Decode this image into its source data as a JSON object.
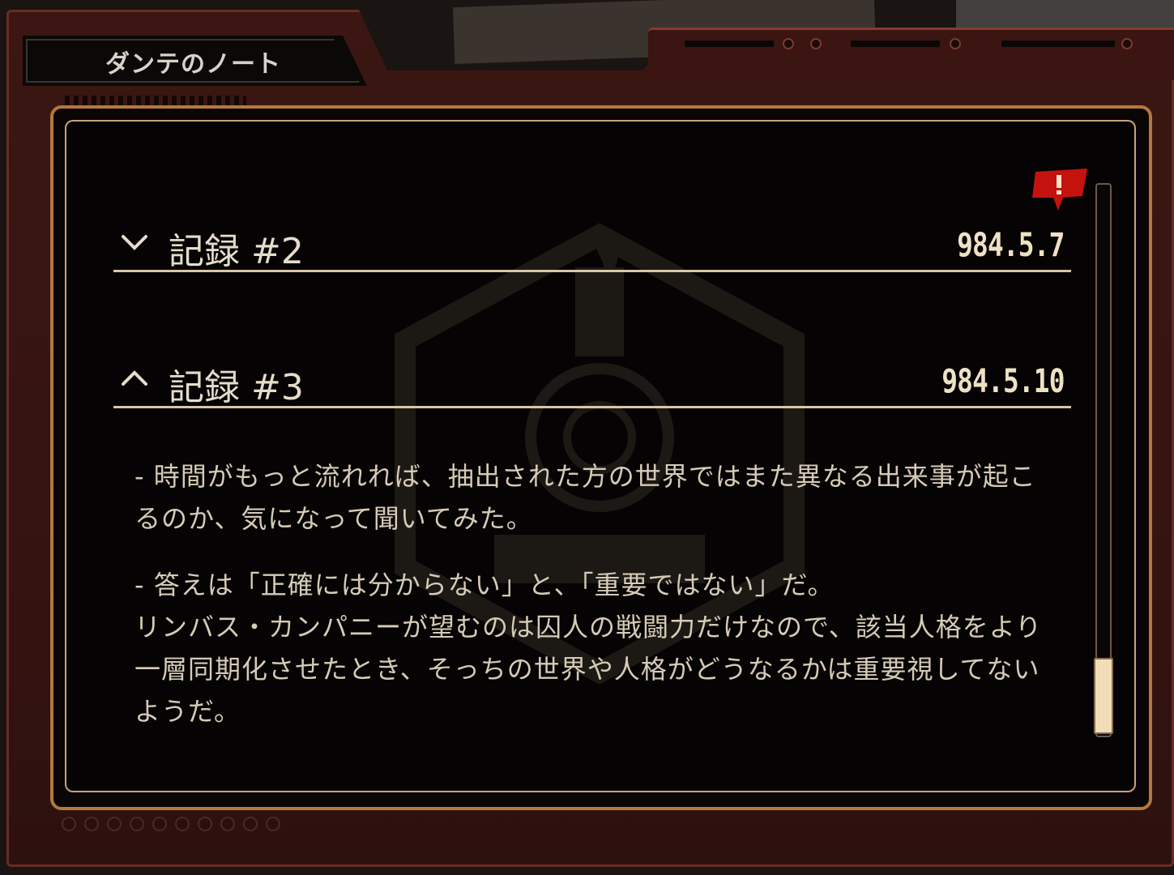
{
  "window": {
    "title": "ダンテのノート"
  },
  "entries": [
    {
      "label": "記録 #2",
      "date": "984.5.7",
      "state": "collapsed",
      "has_alert": true
    },
    {
      "label": "記録 #3",
      "date": "984.5.10",
      "state": "expanded",
      "paragraphs": [
        "- 時間がもっと流れれば、抽出された方の世界ではまた異なる出来事が起こるのか、気になって聞いてみた。",
        "- 答えは「正確には分からない」と、「重要ではない」だ。\nリンバス・カンパニーが望むのは囚人の戦闘力だけなので、該当人格をより一層同期化させたとき、そっちの世界や人格がどうなるかは重要視してないようだ。"
      ]
    }
  ],
  "icons": {
    "collapsed_chevron": "chevron-down-icon",
    "expanded_chevron": "chevron-up-icon",
    "alert": "alert-flag-icon"
  },
  "colors": {
    "frame": "#3b1613",
    "panel_border": "#b6773d",
    "text": "#d6cbb6",
    "accent_alert": "#c4120f",
    "scroll_thumb": "#f1ddb8"
  }
}
